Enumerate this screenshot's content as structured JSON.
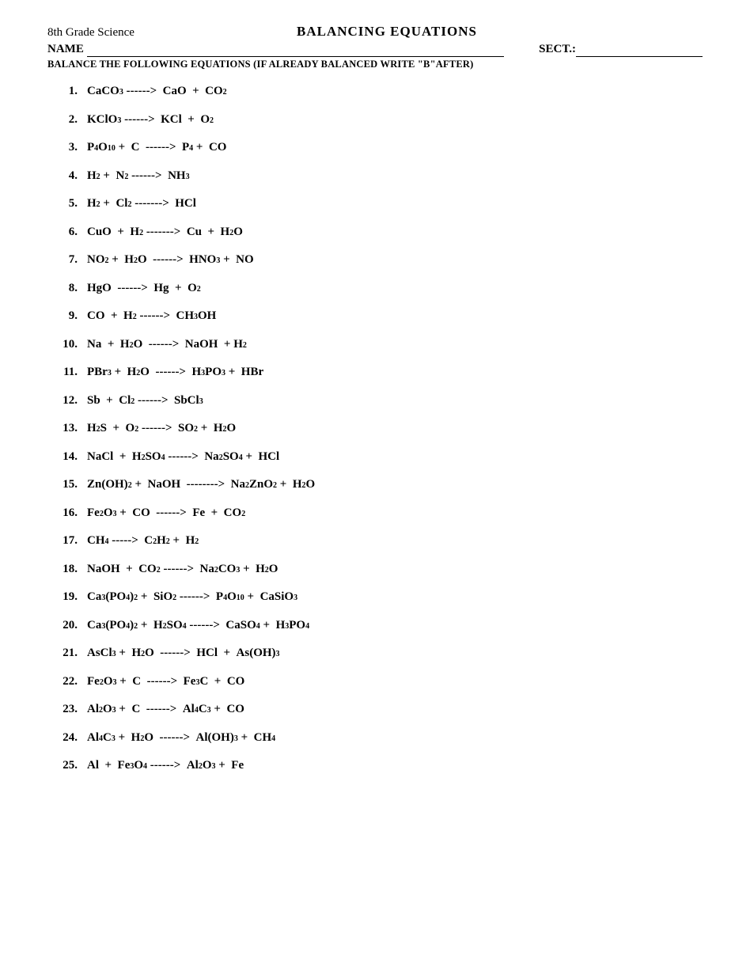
{
  "header": {
    "left": "8th Grade Science",
    "center": "BALANCING EQUATIONS"
  },
  "form": {
    "name_label": "NAME",
    "sect_label": "SECT.:",
    "instructions": "BALANCE THE FOLLOWING EQUATIONS (IF ALREADY BALANCED WRITE \"B\"AFTER)"
  },
  "equations": [
    {
      "num": "1.",
      "html": "CaCO<sub>3</sub> &nbsp;------&gt; &nbsp;CaO &nbsp;+ &nbsp;CO<sub>2</sub>"
    },
    {
      "num": "2.",
      "html": "KClO<sub>3</sub> &nbsp;------&gt; &nbsp;KCl &nbsp;+ &nbsp;O<sub>2</sub>"
    },
    {
      "num": "3.",
      "html": "P<sub>4</sub>O<sub>10</sub> &nbsp;+ &nbsp;C &nbsp;------&gt; &nbsp;P<sub>4</sub> &nbsp;+ &nbsp;CO"
    },
    {
      "num": "4.",
      "html": "H<sub>2</sub> &nbsp;+ &nbsp;N<sub>2</sub> &nbsp;------&gt; &nbsp;NH<sub>3</sub>"
    },
    {
      "num": "5.",
      "html": "H<sub>2</sub> &nbsp;+ &nbsp;Cl<sub>2</sub> &nbsp;-------&gt; &nbsp;HCl"
    },
    {
      "num": "6.",
      "html": "CuO &nbsp;+ &nbsp;H<sub>2</sub> &nbsp;-------&gt; &nbsp;Cu &nbsp;+ &nbsp;H<sub>2</sub>O"
    },
    {
      "num": "7.",
      "html": "NO<sub>2</sub> &nbsp;+ &nbsp;H<sub>2</sub>O &nbsp;------&gt; &nbsp;HNO<sub>3</sub> &nbsp;+ &nbsp;NO"
    },
    {
      "num": "8.",
      "html": "HgO &nbsp;------&gt; &nbsp;Hg &nbsp;+ &nbsp;O<sub>2</sub>"
    },
    {
      "num": "9.",
      "html": "CO &nbsp;+ &nbsp;H<sub>2</sub> &nbsp;------&gt; &nbsp;CH<sub>3</sub>OH"
    },
    {
      "num": "10.",
      "html": "Na &nbsp;+ &nbsp;H<sub>2</sub>O &nbsp;------&gt; &nbsp;NaOH &nbsp;+ H<sub>2</sub>"
    },
    {
      "num": "11.",
      "html": "PBr<sub>3</sub> &nbsp;+ &nbsp;H<sub>2</sub>O &nbsp;------&gt; &nbsp;H<sub>3</sub>PO<sub>3</sub> &nbsp;+ &nbsp;HBr"
    },
    {
      "num": "12.",
      "html": "Sb &nbsp;+ &nbsp;Cl<sub>2</sub> &nbsp;------&gt; &nbsp;SbCl<sub>3</sub>"
    },
    {
      "num": "13.",
      "html": "H<sub>2</sub>S &nbsp;+ &nbsp;O<sub>2</sub> &nbsp;------&gt; &nbsp;SO<sub>2</sub> &nbsp;+ &nbsp;H<sub>2</sub>O"
    },
    {
      "num": "14.",
      "html": "NaCl &nbsp;+ &nbsp;H<sub>2</sub>SO<sub>4</sub> &nbsp;------&gt; &nbsp;Na<sub>2</sub>SO<sub>4</sub> &nbsp;+ &nbsp;HCl"
    },
    {
      "num": "15.",
      "html": "Zn(OH)<sub>2</sub> &nbsp;+ &nbsp;NaOH &nbsp;--------&gt; &nbsp;Na<sub>2</sub>ZnO<sub>2</sub> &nbsp;+ &nbsp;H<sub>2</sub>O"
    },
    {
      "num": "16.",
      "html": "Fe<sub>2</sub>O<sub>3</sub> &nbsp;+ &nbsp;CO &nbsp;------&gt; &nbsp;Fe &nbsp;+ &nbsp;CO<sub>2</sub>"
    },
    {
      "num": "17.",
      "html": "CH<sub>4</sub> &nbsp;-----&gt; &nbsp;C<sub>2</sub>H<sub>2</sub> &nbsp;+ &nbsp;H<sub>2</sub>"
    },
    {
      "num": "18.",
      "html": "NaOH &nbsp;+ &nbsp;CO<sub>2</sub> &nbsp;------&gt; &nbsp;Na<sub>2</sub>CO<sub>3</sub> &nbsp;+ &nbsp;H<sub>2</sub>O"
    },
    {
      "num": "19.",
      "html": "Ca<sub>3</sub>(PO<sub>4</sub>)<sub>2</sub> &nbsp;+ &nbsp;SiO<sub>2</sub> &nbsp;------&gt; &nbsp;P<sub>4</sub>O<sub>10</sub> &nbsp;+ &nbsp;CaSiO<sub>3</sub>"
    },
    {
      "num": "20.",
      "html": "Ca<sub>3</sub>(PO<sub>4</sub>)<sub>2</sub> &nbsp;+ &nbsp;H<sub>2</sub>SO<sub>4</sub> &nbsp;------&gt; &nbsp;CaSO<sub>4</sub> &nbsp;+ &nbsp;H<sub>3</sub>PO<sub>4</sub>"
    },
    {
      "num": "21.",
      "html": "AsCl<sub>3</sub> &nbsp;+ &nbsp;H<sub>2</sub>O &nbsp;------&gt; &nbsp;HCl &nbsp;+ &nbsp;As(OH)<sub>3</sub>"
    },
    {
      "num": "22.",
      "html": "Fe<sub>2</sub>O<sub>3</sub> &nbsp;+ &nbsp;C &nbsp;------&gt; &nbsp;Fe<sub>3</sub>C &nbsp;+ &nbsp;CO"
    },
    {
      "num": "23.",
      "html": "Al<sub>2</sub>O<sub>3</sub> &nbsp;+ &nbsp;C &nbsp;------&gt; &nbsp;Al<sub>4</sub>C<sub>3</sub> &nbsp;+ &nbsp;CO"
    },
    {
      "num": "24.",
      "html": "Al<sub>4</sub>C<sub>3</sub> &nbsp;+ &nbsp;H<sub>2</sub>O &nbsp;------&gt; &nbsp;Al(OH)<sub>3</sub> &nbsp;+ &nbsp;CH<sub>4</sub>"
    },
    {
      "num": "25.",
      "html": "Al &nbsp;+ &nbsp;Fe<sub>3</sub>O<sub>4</sub> &nbsp;------&gt; &nbsp;Al<sub>2</sub>O<sub>3</sub> &nbsp;+ &nbsp;Fe"
    }
  ]
}
